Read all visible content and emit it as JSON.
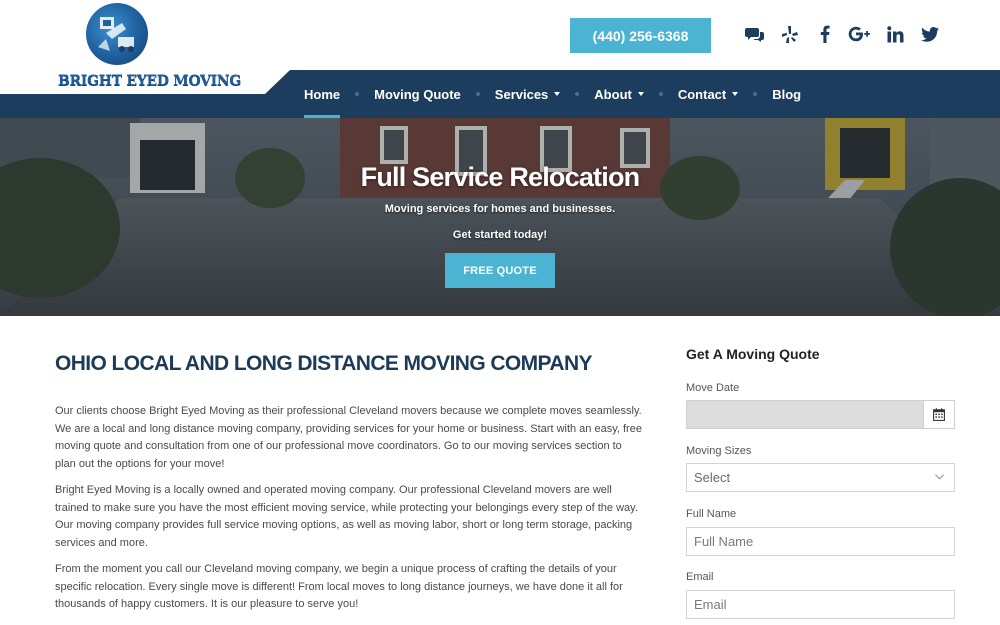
{
  "brand": {
    "logo_text": "BRIGHT EYED MOVING",
    "colors": {
      "navy": "#1c3d5e",
      "accent": "#4ab4d2",
      "heading": "#1d3a57"
    }
  },
  "header": {
    "phone": "(440) 256-6368",
    "social": [
      "chat-icon",
      "yelp-icon",
      "facebook-icon",
      "google-plus-icon",
      "linkedin-icon",
      "twitter-icon"
    ]
  },
  "nav": {
    "items": [
      {
        "label": "Home",
        "active": true
      },
      {
        "label": "Moving Quote"
      },
      {
        "label": "Services",
        "dropdown": true
      },
      {
        "label": "About",
        "dropdown": true
      },
      {
        "label": "Contact",
        "dropdown": true
      },
      {
        "label": "Blog"
      }
    ]
  },
  "hero": {
    "title": "Full Service Relocation",
    "subtitle": "Moving services for homes and businesses.",
    "cta_text": "Get started today!",
    "button": "FREE QUOTE"
  },
  "main": {
    "title": "OHIO LOCAL AND LONG DISTANCE MOVING COMPANY",
    "paragraphs": [
      "Our clients choose Bright Eyed Moving as their professional Cleveland movers because we complete moves seamlessly. We are a local and long distance moving company, providing services for your home or business. Start with an easy, free moving quote and consultation from one of our professional move coordinators. Go to our moving services section to plan out the options for your move!",
      "Bright Eyed Moving is a locally owned and operated moving company. Our professional Cleveland movers are well trained to make sure you have the most efficient moving service, while protecting your belongings every step of the way. Our moving company provides full service moving options, as well as moving labor, short or long term storage, packing services and more.",
      "From the moment you call our Cleveland moving company, we begin a unique process of crafting the details of your specific relocation. Every single move is different! From local moves to long distance journeys, we have done it all for thousands of happy customers. It is our pleasure to serve you!"
    ]
  },
  "quote_form": {
    "title": "Get A Moving Quote",
    "move_date_label": "Move Date",
    "move_date_value": "",
    "moving_sizes_label": "Moving Sizes",
    "moving_sizes_selected": "Select",
    "full_name_label": "Full Name",
    "full_name_placeholder": "Full Name",
    "email_label": "Email",
    "email_placeholder": "Email"
  }
}
